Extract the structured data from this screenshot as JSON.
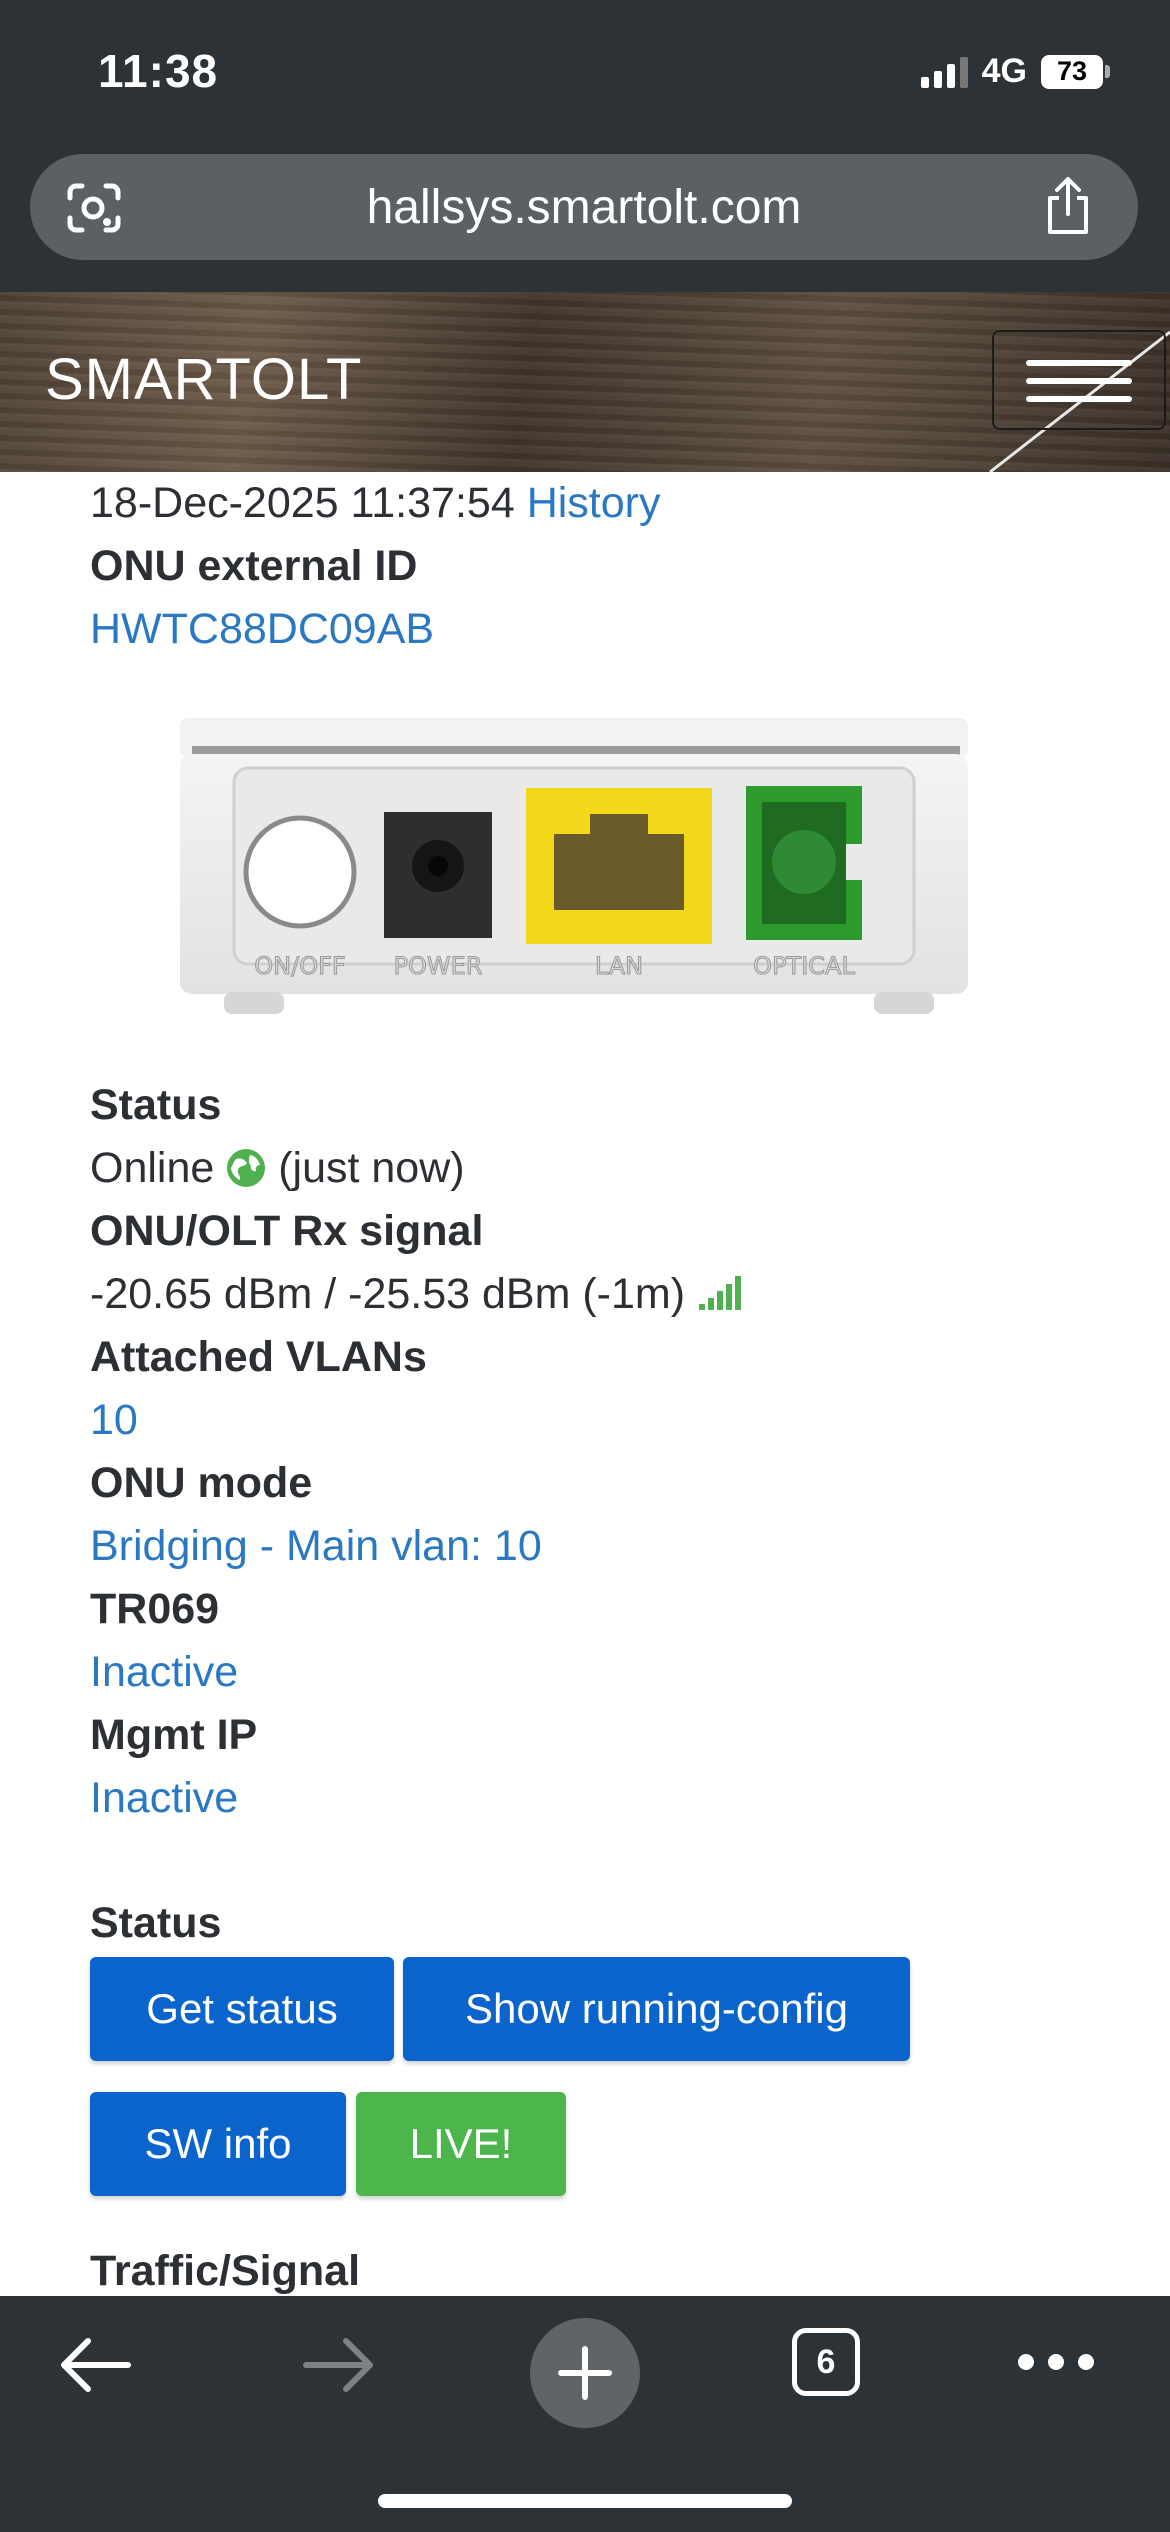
{
  "status_bar": {
    "time": "11:38",
    "network": "4G",
    "battery": "73"
  },
  "browser": {
    "url": "hallsys.smartolt.com",
    "tab_count": "6"
  },
  "navbar": {
    "brand": "SMARTOLT"
  },
  "onu": {
    "last_updated": "18-Dec-2025 11:37:54",
    "history_link": "History",
    "external_id_label": "ONU external ID",
    "external_id": "HWTC88DC09AB",
    "device_ports": [
      "ON/OFF",
      "POWER",
      "LAN",
      "OPTICAL"
    ],
    "status_label": "Status",
    "status_value": "Online",
    "status_time": "(just now)",
    "signal_label": "ONU/OLT Rx signal",
    "signal_value": "-20.65 dBm / -25.53 dBm (-1m)",
    "vlans_label": "Attached VLANs",
    "vlans_value": "10",
    "mode_label": "ONU mode",
    "mode_value": "Bridging - Main vlan: 10",
    "tr069_label": "TR069",
    "tr069_value": "Inactive",
    "mgmt_ip_label": "Mgmt IP",
    "mgmt_ip_value": "Inactive"
  },
  "actions": {
    "section_label": "Status",
    "get_status": "Get status",
    "show_running_config": "Show running-config",
    "sw_info": "SW info",
    "live": "LIVE!"
  },
  "traffic": {
    "section_label": "Traffic/Signal"
  },
  "colors": {
    "link": "#2a78c2",
    "button_blue": "#0b64cc",
    "button_green": "#4cb64c",
    "online_green": "#4fb04f"
  }
}
